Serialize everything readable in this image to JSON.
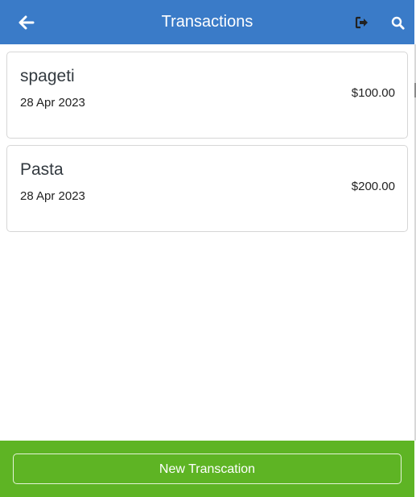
{
  "header": {
    "title": "Transactions",
    "back_icon": "arrow-left-icon",
    "logout_icon": "sign-out-icon",
    "search_icon": "search-icon",
    "background_color": "#3a7bc8"
  },
  "transactions": [
    {
      "name": "spageti",
      "date": "28 Apr 2023",
      "amount": "$100.00"
    },
    {
      "name": "Pasta",
      "date": "28 Apr 2023",
      "amount": "$200.00"
    }
  ],
  "footer": {
    "new_button_label": "New Transcation",
    "background_color": "#5eb424"
  }
}
